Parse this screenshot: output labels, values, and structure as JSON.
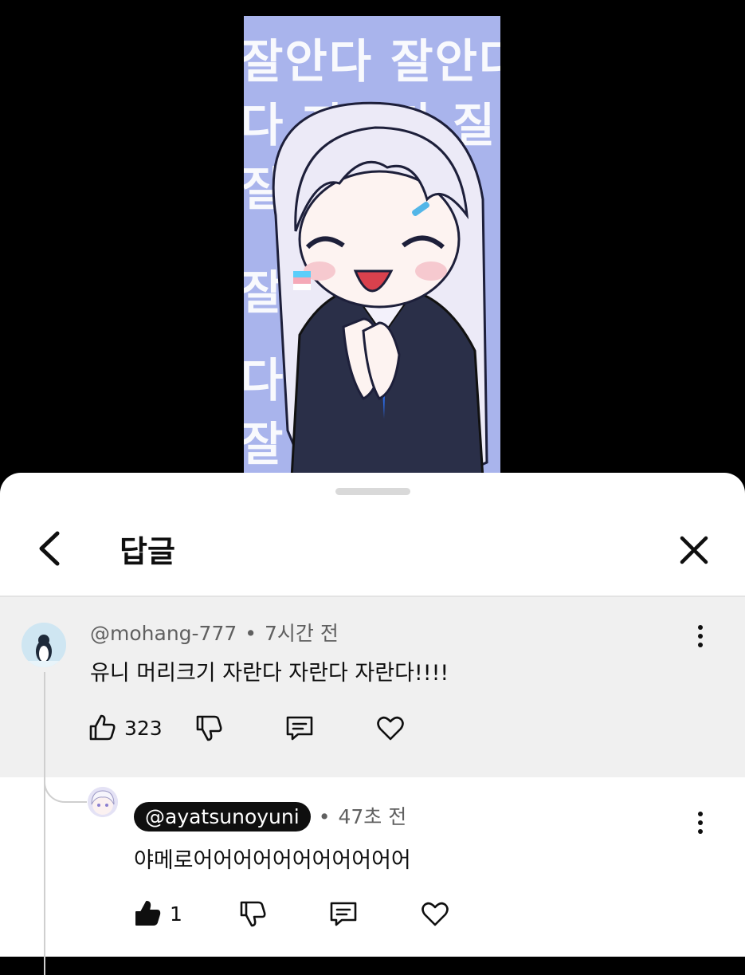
{
  "video": {
    "bg_text_lines": [
      "잘안다 잘안다",
      "다 자한다 질",
      "질",
      "잘",
      "다",
      "잘"
    ],
    "bg_color": "#a9b4ec"
  },
  "sheet": {
    "title": "답글",
    "back_icon": "chevron-left-icon",
    "close_icon": "close-icon"
  },
  "parent_comment": {
    "author": "@mohang-777",
    "separator": "•",
    "time": "7시간 전",
    "text": "유니 머리크기 자란다 자란다 자란다!!!!",
    "like_count": "323"
  },
  "reply": {
    "author": "@ayatsunoyuni",
    "separator": "•",
    "time": "47초 전",
    "text": "야메로어어어어어어어어어어어",
    "like_count": "1"
  }
}
